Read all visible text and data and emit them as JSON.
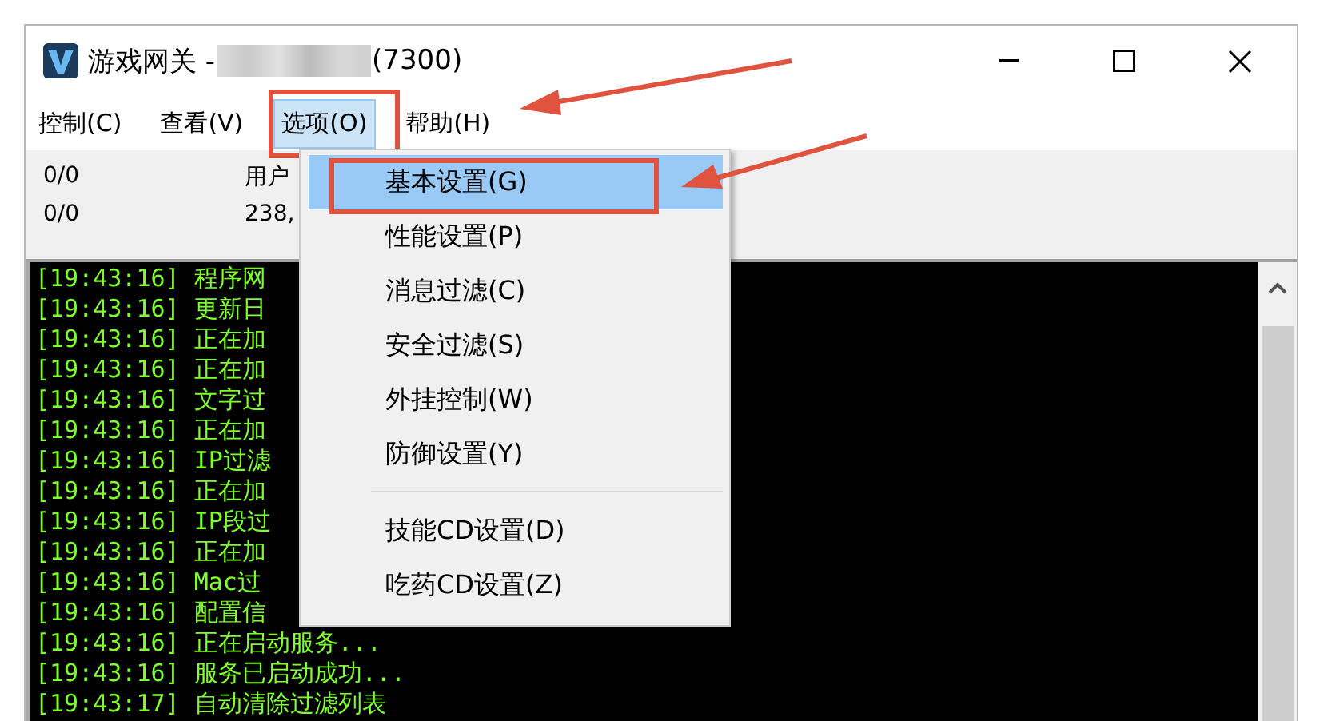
{
  "window": {
    "title": "游戏网关 - ",
    "title_suffix": "(7300)"
  },
  "menubar": [
    {
      "label": "控制(C)",
      "selected": false,
      "highlighted": false
    },
    {
      "label": "查看(V)",
      "selected": false,
      "highlighted": false
    },
    {
      "label": "选项(O)",
      "selected": true,
      "highlighted": true
    },
    {
      "label": "帮助(H)",
      "selected": false,
      "highlighted": false
    }
  ],
  "status": {
    "rows": [
      [
        "0/0",
        "用户"
      ],
      [
        "0/0",
        "238,"
      ]
    ]
  },
  "log": [
    {
      "time": "[19:43:16]",
      "text": "程序网"
    },
    {
      "time": "[19:43:16]",
      "text": "更新日"
    },
    {
      "time": "[19:43:16]",
      "text": "正在加"
    },
    {
      "time": "[19:43:16]",
      "text": "正在加"
    },
    {
      "time": "[19:43:16]",
      "text": "文字过"
    },
    {
      "time": "[19:43:16]",
      "text": "正在加"
    },
    {
      "time": "[19:43:16]",
      "text": "IP过滤"
    },
    {
      "time": "[19:43:16]",
      "text": "正在加"
    },
    {
      "time": "[19:43:16]",
      "text": "IP段过"
    },
    {
      "time": "[19:43:16]",
      "text": "正在加"
    },
    {
      "time": "[19:43:16]",
      "text": "Mac过"
    },
    {
      "time": "[19:43:16]",
      "text": "配置信"
    },
    {
      "time": "[19:43:16]",
      "text": "正在启动服务..."
    },
    {
      "time": "[19:43:16]",
      "text": "服务已启动成功..."
    },
    {
      "time": "[19:43:17]",
      "text": "自动清除过滤列表"
    }
  ],
  "dropdown": [
    {
      "kind": "item",
      "label": "基本设置(G)",
      "selected": true,
      "highlighted": true
    },
    {
      "kind": "item",
      "label": "性能设置(P)",
      "selected": false,
      "highlighted": false
    },
    {
      "kind": "item",
      "label": "消息过滤(C)",
      "selected": false,
      "highlighted": false
    },
    {
      "kind": "item",
      "label": "安全过滤(S)",
      "selected": false,
      "highlighted": false
    },
    {
      "kind": "item",
      "label": "外挂控制(W)",
      "selected": false,
      "highlighted": false
    },
    {
      "kind": "item",
      "label": "防御设置(Y)",
      "selected": false,
      "highlighted": false
    },
    {
      "kind": "separator"
    },
    {
      "kind": "item",
      "label": "技能CD设置(D)",
      "selected": false,
      "highlighted": false
    },
    {
      "kind": "item",
      "label": "吃药CD设置(Z)",
      "selected": false,
      "highlighted": false
    }
  ]
}
